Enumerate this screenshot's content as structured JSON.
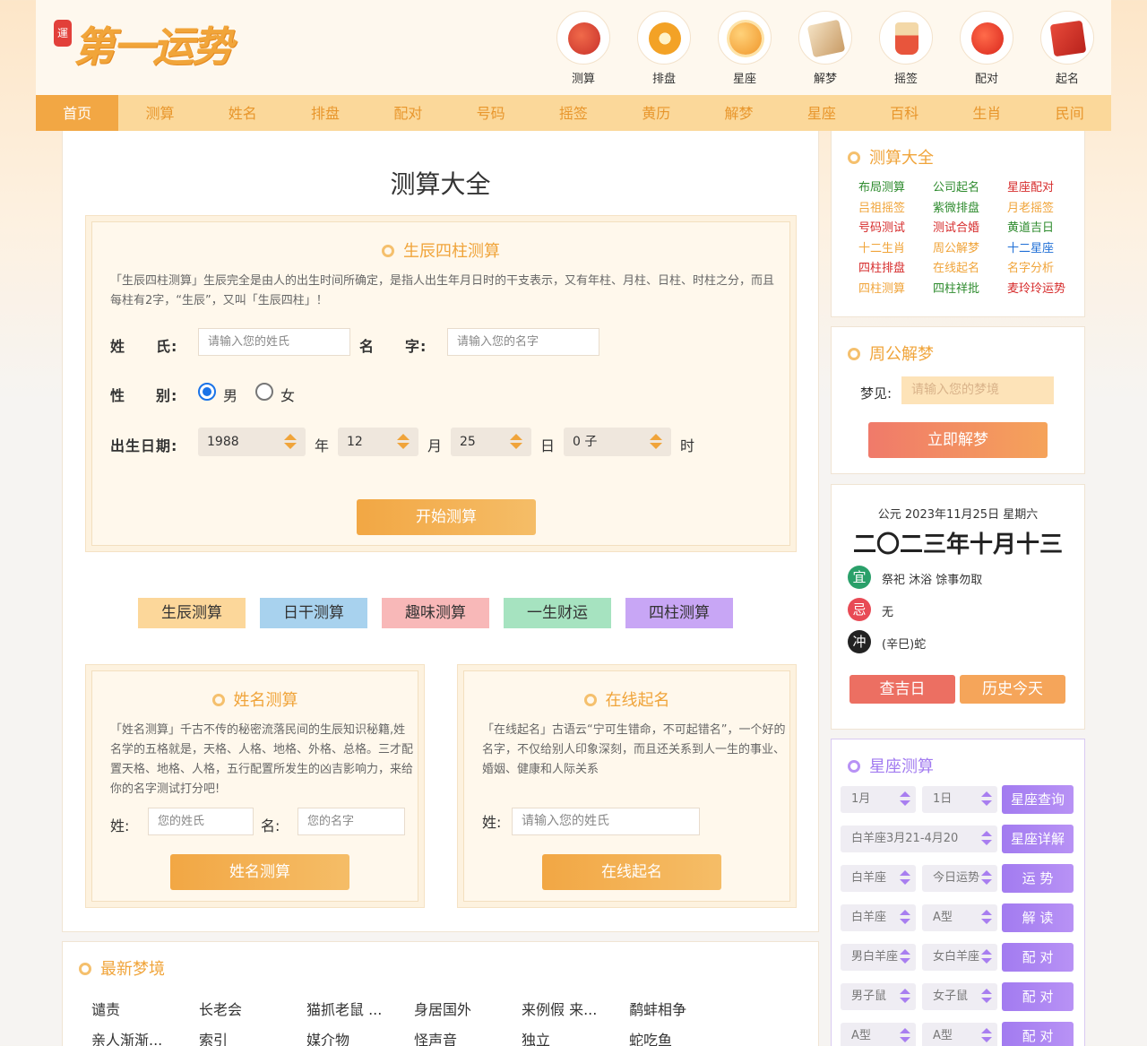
{
  "logo": {
    "seal": "運",
    "text": "第一运势"
  },
  "top_icons": [
    {
      "label": "测算",
      "icon": "fortune-bag-icon",
      "color": "#e0463a"
    },
    {
      "label": "排盘",
      "icon": "bagua-icon",
      "color": "#f3a226"
    },
    {
      "label": "星座",
      "icon": "planet-icon",
      "color": "#f2a53a"
    },
    {
      "label": "解梦",
      "icon": "dream-book-icon",
      "color": "#d8b07a"
    },
    {
      "label": "摇签",
      "icon": "fortune-sticks-icon",
      "color": "#e8553c"
    },
    {
      "label": "配对",
      "icon": "hearts-icon",
      "color": "#e8402f"
    },
    {
      "label": "起名",
      "icon": "name-book-icon",
      "color": "#d9362c"
    }
  ],
  "nav": [
    "首页",
    "测算",
    "姓名",
    "排盘",
    "配对",
    "号码",
    "摇签",
    "黄历",
    "解梦",
    "星座",
    "百科",
    "生肖",
    "民间"
  ],
  "main": {
    "title": "测算大全",
    "bazi": {
      "title": "生辰四柱测算",
      "desc": "「生辰四柱测算」生辰完全是由人的出生时间所确定，是指人出生年月日时的干支表示，又有年柱、月柱、日柱、时柱之分，而且每柱有2字，“生辰”，又叫「生辰四柱」！",
      "surname_label": "姓　　氏:",
      "surname_placeholder": "请输入您的姓氏",
      "name_label": "名　　字:",
      "name_placeholder": "请输入您的名字",
      "gender_label": "性　　别:",
      "male": "男",
      "female": "女",
      "birth_label": "出生日期:",
      "year": "1988",
      "year_unit": "年",
      "month": "12",
      "month_unit": "月",
      "day": "25",
      "day_unit": "日",
      "hour": "0 子",
      "hour_unit": "时",
      "submit": "开始测算"
    },
    "tabs": [
      {
        "label": "生辰测算",
        "color": "#fcd79a"
      },
      {
        "label": "日干测算",
        "color": "#a8d2ee"
      },
      {
        "label": "趣味测算",
        "color": "#f8b8b8"
      },
      {
        "label": "一生财运",
        "color": "#a6e3c0"
      },
      {
        "label": "四柱测算",
        "color": "#c8a6f5"
      }
    ],
    "name_test": {
      "title": "姓名测算",
      "desc": "「姓名测算」千古不传的秘密流落民间的生辰知识秘籍,姓名学的五格就是，天格、人格、地格、外格、总格。三才配置天格、地格、人格，五行配置所发生的凶吉影响力，来给你的名字测试打分吧!",
      "surname_label": "姓:",
      "surname_placeholder": "您的姓氏",
      "name_label": "名:",
      "name_placeholder": "您的名字",
      "submit": "姓名测算"
    },
    "naming": {
      "title": "在线起名",
      "desc": "「在线起名」古语云“宁可生错命，不可起错名”，一个好的名字，不仅给别人印象深刻，而且还关系到人一生的事业、婚姻、健康和人际关系",
      "surname_label": "姓:",
      "surname_placeholder": "请输入您的姓氏",
      "submit": "在线起名"
    }
  },
  "sidebar": {
    "divination": {
      "title": "测算大全",
      "links": [
        {
          "text": "布局测算",
          "color": "#2e8b2e"
        },
        {
          "text": "公司起名",
          "color": "#2e8b2e"
        },
        {
          "text": "星座配对",
          "color": "#d62b2b"
        },
        {
          "text": "吕祖摇签",
          "color": "#f0a43a"
        },
        {
          "text": "紫微排盘",
          "color": "#2e8b2e"
        },
        {
          "text": "月老摇签",
          "color": "#f0a43a"
        },
        {
          "text": "号码测试",
          "color": "#d62b2b"
        },
        {
          "text": "测试合婚",
          "color": "#d62b2b"
        },
        {
          "text": "黄道吉日",
          "color": "#2e8b2e"
        },
        {
          "text": "十二生肖",
          "color": "#f0a43a"
        },
        {
          "text": "周公解梦",
          "color": "#f0a43a"
        },
        {
          "text": "十二星座",
          "color": "#1f6fd6"
        },
        {
          "text": "四柱排盘",
          "color": "#d62b2b"
        },
        {
          "text": "在线起名",
          "color": "#f0a43a"
        },
        {
          "text": "名字分析",
          "color": "#f0a43a"
        },
        {
          "text": "四柱测算",
          "color": "#f0a43a"
        },
        {
          "text": "四柱祥批",
          "color": "#2e8b2e"
        },
        {
          "text": "麦玲玲运势",
          "color": "#d62b2b"
        }
      ]
    },
    "dream": {
      "title": "周公解梦",
      "label": "梦见:",
      "placeholder": "请输入您的梦境",
      "submit": "立即解梦"
    },
    "almanac": {
      "solar": "公元 2023年11月25日 星期六",
      "lunar": "二〇二三年十月十三",
      "yi_badge": "宜",
      "yi": "祭祀 沐浴 馀事勿取",
      "ji_badge": "忌",
      "ji": "无",
      "chong_badge": "冲",
      "chong": "(辛巳)蛇",
      "btn_lucky": "查吉日",
      "btn_history": "历史今天"
    },
    "zodiac": {
      "title": "星座测算",
      "rows": [
        {
          "a": "1月",
          "b": "1日",
          "btn": "星座查询"
        },
        {
          "a": "白羊座3月21-4月20",
          "btn": "星座详解"
        },
        {
          "a": "白羊座",
          "b": "今日运势",
          "btn": "运 势"
        },
        {
          "a": "白羊座",
          "b": "A型",
          "btn": "解 读"
        },
        {
          "a": "男白羊座",
          "b": "女白羊座",
          "btn": "配 对"
        },
        {
          "a": "男子鼠",
          "b": "女子鼠",
          "btn": "配 对"
        },
        {
          "a": "A型",
          "b": "A型",
          "btn": "配 对"
        }
      ]
    }
  },
  "latest_dreams": {
    "title": "最新梦境",
    "items": [
      "谴责",
      "长老会",
      "猫抓老鼠 ...",
      "身居国外",
      "来例假 来...",
      "鹬蚌相争",
      "亲人渐渐...",
      "索引",
      "媒介物",
      "怪声音",
      "独立",
      "蛇吃鱼"
    ]
  }
}
